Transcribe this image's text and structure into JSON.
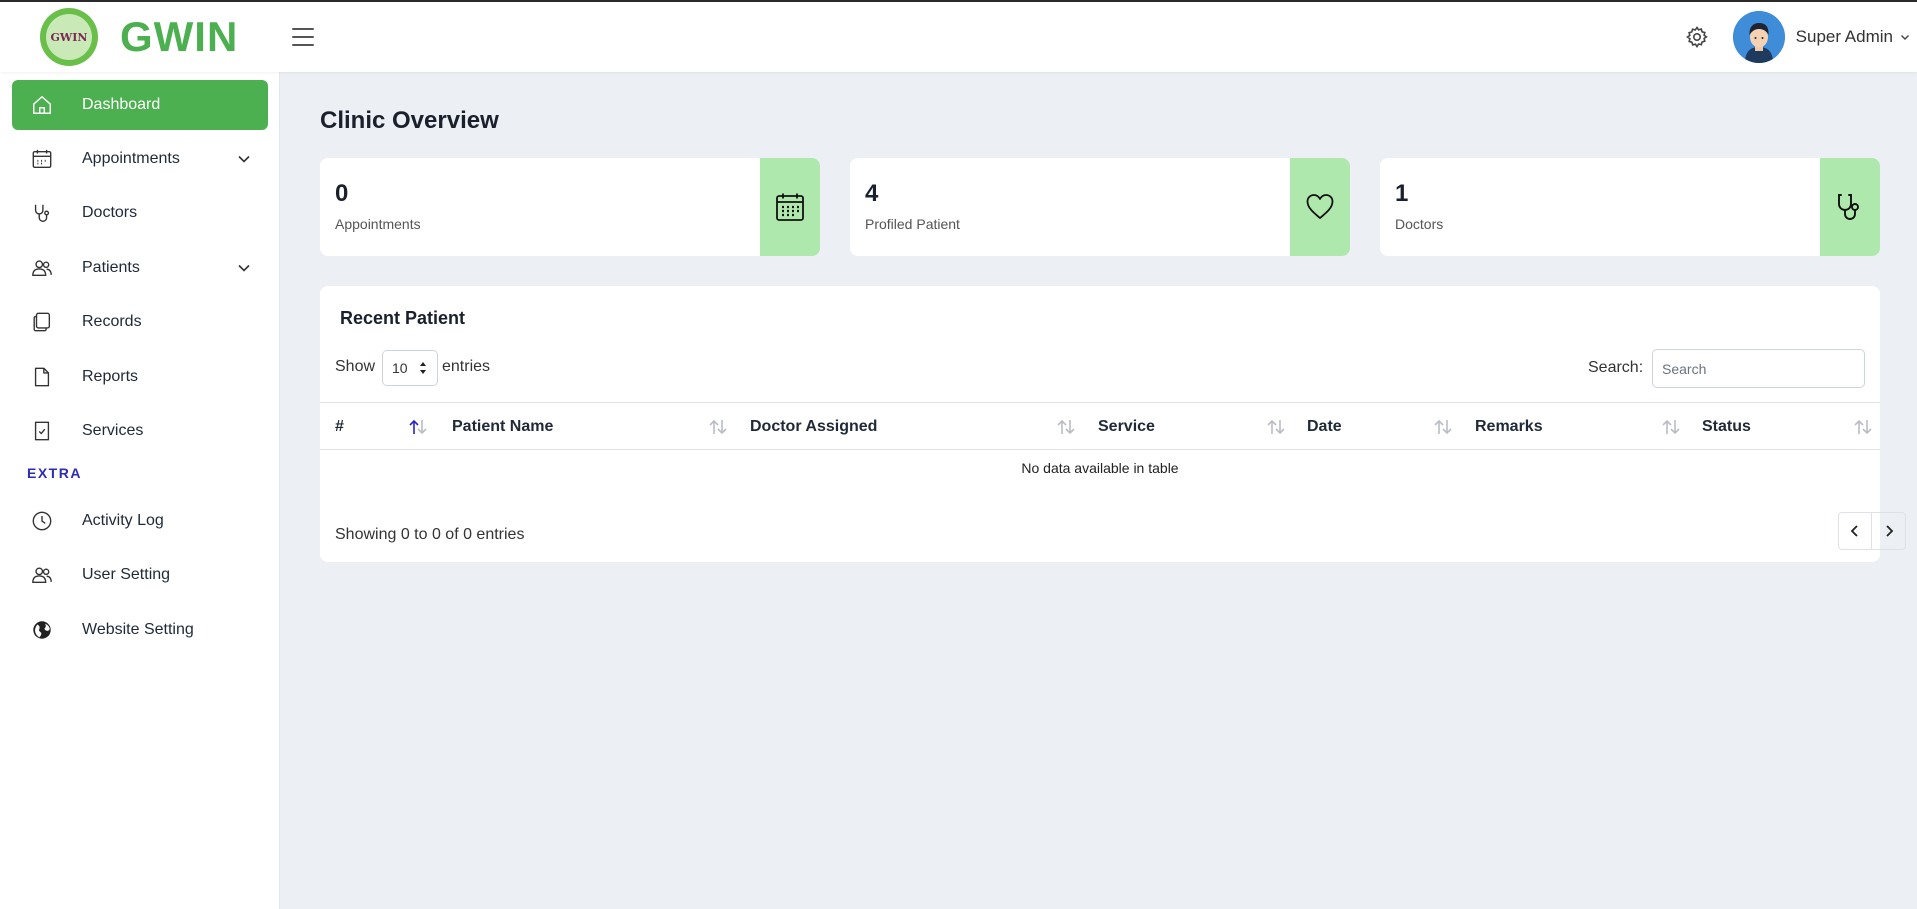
{
  "brand": {
    "name": "GWIN",
    "logo_text": "GWIN",
    "logo_color": "#4caf50"
  },
  "header": {
    "user_name": "Super Admin"
  },
  "sidebar": {
    "items": [
      {
        "label": "Dashboard",
        "icon": "home-icon",
        "active": true
      },
      {
        "label": "Appointments",
        "icon": "calendar-icon",
        "has_children": true
      },
      {
        "label": "Doctors",
        "icon": "stethoscope-icon"
      },
      {
        "label": "Patients",
        "icon": "users-icon",
        "has_children": true
      },
      {
        "label": "Records",
        "icon": "copy-icon"
      },
      {
        "label": "Reports",
        "icon": "file-icon"
      },
      {
        "label": "Services",
        "icon": "file-check-icon"
      }
    ],
    "section_label": "EXTRA",
    "extra_items": [
      {
        "label": "Activity Log",
        "icon": "clock-icon"
      },
      {
        "label": "User Setting",
        "icon": "users-icon"
      },
      {
        "label": "Website Setting",
        "icon": "globe-icon"
      }
    ]
  },
  "main": {
    "title": "Clinic Overview",
    "stats": [
      {
        "value": "0",
        "label": "Appointments",
        "icon": "calendar-icon"
      },
      {
        "value": "4",
        "label": "Profiled Patient",
        "icon": "heart-icon"
      },
      {
        "value": "1",
        "label": "Doctors",
        "icon": "stethoscope-icon"
      }
    ],
    "accent_color": "#aee8ad"
  },
  "table": {
    "title": "Recent Patient",
    "show_label": "Show",
    "entries_value": "10",
    "entries_label": "entries",
    "search_label": "Search:",
    "search_placeholder": "Search",
    "columns": [
      "#",
      "Patient Name",
      "Doctor Assigned",
      "Service",
      "Date",
      "Remarks",
      "Status"
    ],
    "empty_message": "No data available in table",
    "info": "Showing 0 to 0 of 0 entries"
  }
}
